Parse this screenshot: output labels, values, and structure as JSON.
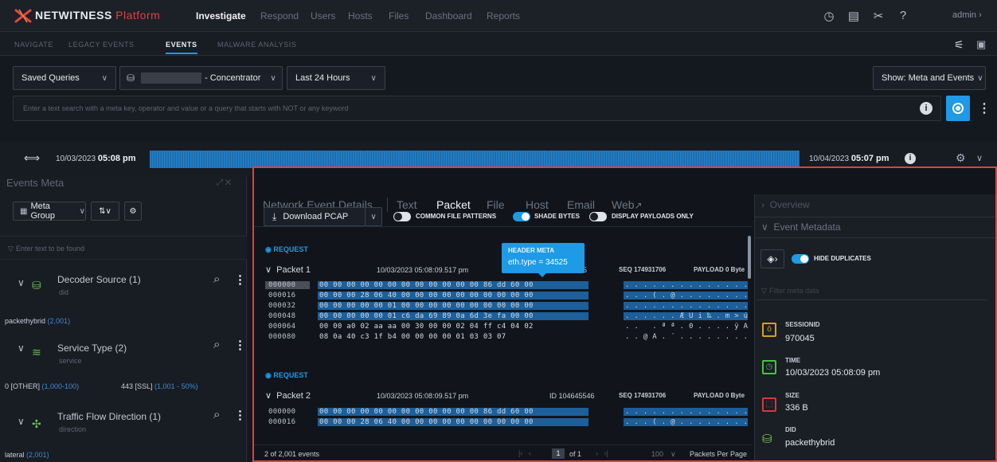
{
  "app": {
    "brand": "NETWITNESS",
    "brand_suffix": "Platform"
  },
  "topnav": {
    "items": [
      "Investigate",
      "Respond",
      "Users",
      "Hosts",
      "Files",
      "Dashboard",
      "Reports"
    ],
    "active": "Investigate",
    "user": "admin"
  },
  "subnav": {
    "items": [
      "NAVIGATE",
      "LEGACY EVENTS",
      "EVENTS",
      "MALWARE ANALYSIS"
    ],
    "active": "EVENTS"
  },
  "query": {
    "saved_queries": "Saved Queries",
    "service": "- Concentrator",
    "time_range": "Last 24 Hours",
    "show_mode": "Show: Meta and Events",
    "search_placeholder": "Enter a text search with a meta key, operator and value or a query that starts with NOT or any keyword"
  },
  "timeline": {
    "start_date": "10/03/2023",
    "start_time": "05:08 pm",
    "end_date": "10/04/2023",
    "end_time": "05:07 pm"
  },
  "events_meta": {
    "title": "Events Meta",
    "group_label": "Meta Group",
    "filter_placeholder": "Enter text to be found",
    "items": [
      {
        "title": "Decoder Source (1)",
        "key": "did",
        "values": [
          {
            "label": "packethybrid",
            "count": "(2,001)"
          }
        ]
      },
      {
        "title": "Service Type (2)",
        "key": "service",
        "values": [
          {
            "label": "0 [OTHER]",
            "count": "(1,000-100)"
          },
          {
            "label": "443 [SSL]",
            "count": "(1,001 - 50%)"
          }
        ]
      },
      {
        "title": "Traffic Flow Direction (1)",
        "key": "direction",
        "values": [
          {
            "label": "lateral",
            "count": "(2,001)"
          }
        ]
      }
    ]
  },
  "details": {
    "tabs": [
      "Network Event Details",
      "Text",
      "Packet",
      "File",
      "Host",
      "Email",
      "Web"
    ],
    "active_tab": "Packet",
    "download_label": "Download PCAP",
    "toggles": [
      {
        "label": "COMMON FILE PATTERNS",
        "on": false
      },
      {
        "label": "SHADE BYTES",
        "on": true
      },
      {
        "label": "DISPLAY PAYLOADS ONLY",
        "on": false
      }
    ],
    "tooltip": {
      "title": "HEADER META",
      "value": "eth.type = 34525"
    },
    "packets": [
      {
        "direction": "REQUEST",
        "name": "Packet 1",
        "timestamp": "10/03/2023 05:08:09.517 pm",
        "id": "45",
        "seq": "SEQ 174931706",
        "payload": "PAYLOAD 0 Byte",
        "rows": [
          {
            "offset": "000000",
            "bytes": "00 00 00 00 00 00 00 00 00 00 00 00 86 dd 60 00",
            "ascii": ". . . . . . . . . . . . . . Ÿ `"
          },
          {
            "offset": "000016",
            "bytes": "00 00 00 28 06 40 00 00 00 00 00 00 00 00 00 00",
            "ascii": ". . . ( . @ . . . . . . . . . ."
          },
          {
            "offset": "000032",
            "bytes": "00 00 00 00 00 01 00 00 00 00 00 00 00 00 00 00",
            "ascii": ". . . . . . . . . . . . . . . ."
          },
          {
            "offset": "000048",
            "bytes": "00 00 00 00 00 01 c6 da 69 89 0a 6d 3e fa 00 00",
            "ascii": ". . . . . . Æ Ú i ‰ . m > ú . ."
          },
          {
            "offset": "000064",
            "bytes": "00 00 a0 02 aa aa 00 30 00 00 02 04 ff c4 04 02",
            "ascii": ". .   . ª ª . 0 . . . . ÿ Ä . ."
          },
          {
            "offset": "000080",
            "bytes": "08 0a 40 c3 1f b4 00 00 00 00 01 03 03 07",
            "ascii": ". . @ Ã . ´ . . . . . . . ."
          }
        ]
      },
      {
        "direction": "REQUEST",
        "name": "Packet 2",
        "timestamp": "10/03/2023 05:08:09.517 pm",
        "id": "ID 104645546",
        "seq": "SEQ 174931706",
        "payload": "PAYLOAD 0 Byte",
        "rows": [
          {
            "offset": "000000",
            "bytes": "00 00 00 00 00 00 00 00 00 00 00 00 86 dd 60 00",
            "ascii": ". . . . . . . . . . . . . . Ÿ `"
          },
          {
            "offset": "000016",
            "bytes": "00 00 00 28 06 40 00 00 00 00 00 00 00 00 00 00",
            "ascii": ". . . ( . @ . . . . . . . . . ."
          }
        ]
      }
    ],
    "footer": {
      "event_count": "2 of 2,001 events",
      "page": "1",
      "of": "of 1",
      "per_page": "100",
      "per_page_label": "Packets Per Page"
    }
  },
  "side": {
    "overview": "Overview",
    "event_metadata": "Event Metadata",
    "hide_duplicates": "HIDE DUPLICATES",
    "filter_placeholder": "Filter meta data",
    "meta": [
      {
        "key": "SESSIONID",
        "value": "970045",
        "color": "#d8a020"
      },
      {
        "key": "TIME",
        "value": "10/03/2023 05:08:09 pm",
        "color": "#4cbf4a"
      },
      {
        "key": "SIZE",
        "value": "336 B",
        "color": "#d33a3a"
      },
      {
        "key": "DID",
        "value": "packethybrid",
        "color": "#7bc24a"
      }
    ]
  },
  "colors": {
    "accent": "#1e9ae6",
    "border_highlight": "#e2403c",
    "brand_red": "#e04040"
  }
}
